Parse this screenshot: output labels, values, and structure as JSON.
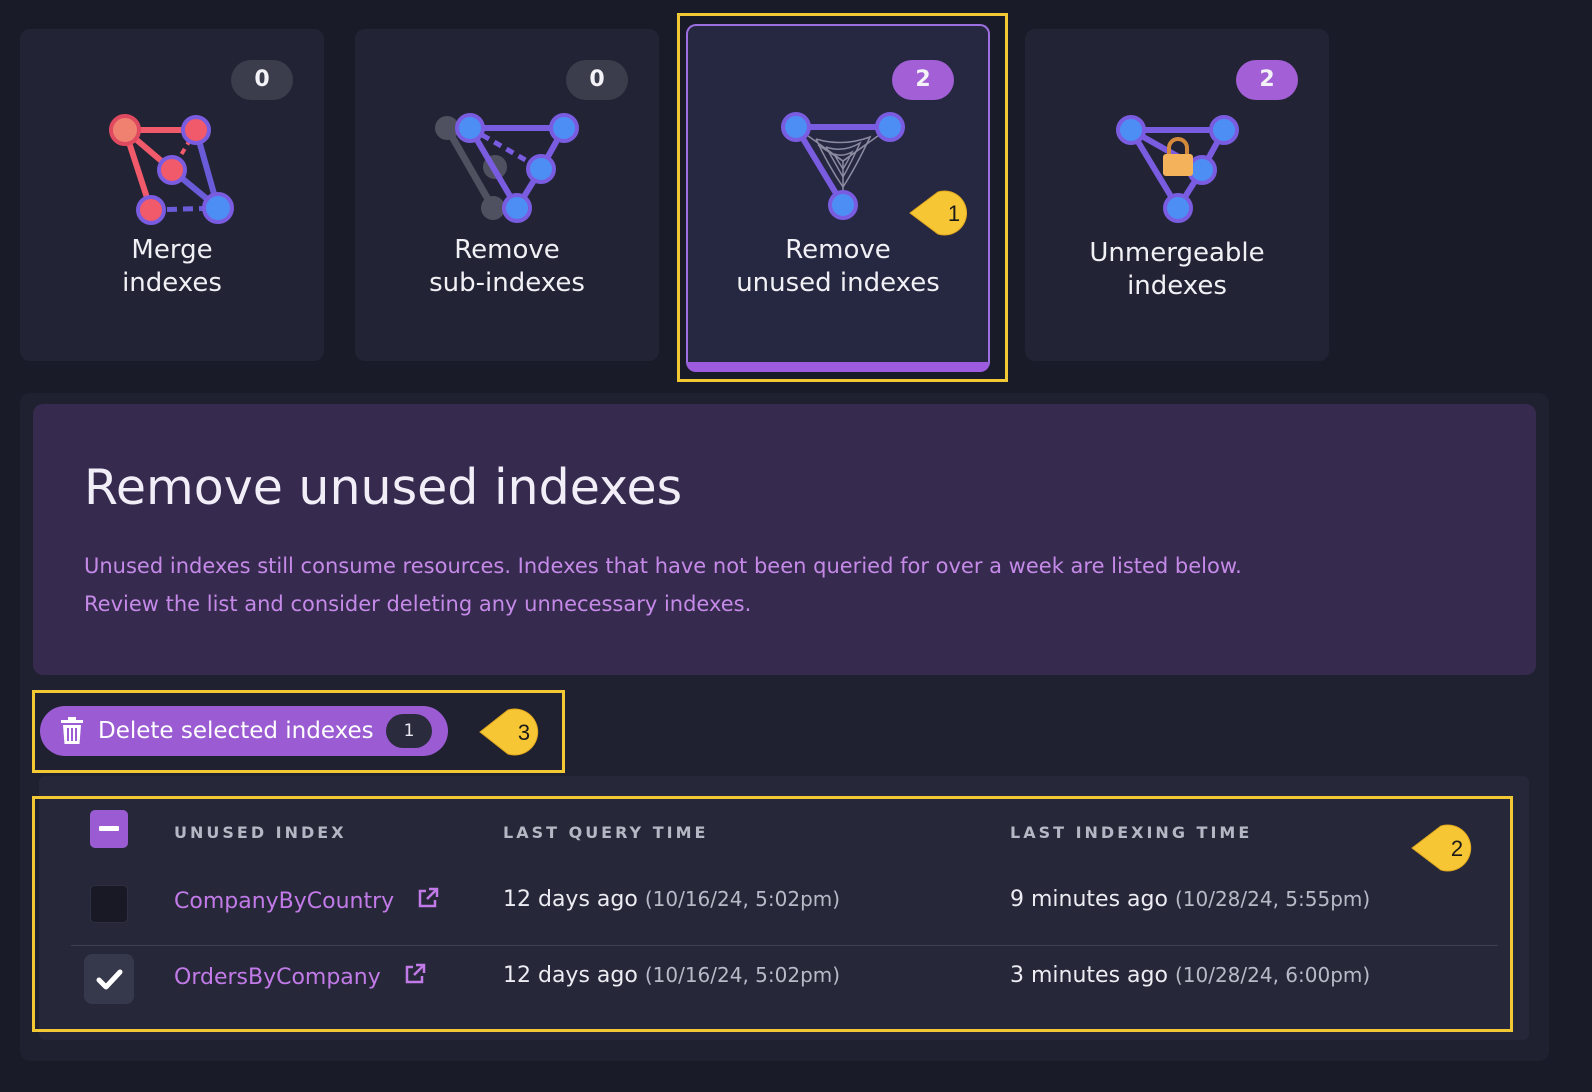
{
  "cards": [
    {
      "line1": "Merge",
      "line2": "indexes",
      "count": "0"
    },
    {
      "line1": "Remove",
      "line2": "sub-indexes",
      "count": "0"
    },
    {
      "line1": "Remove",
      "line2": "unused indexes",
      "count": "2"
    },
    {
      "line1": "Unmergeable",
      "line2": "indexes",
      "count": "2"
    }
  ],
  "callouts": {
    "one": "1",
    "two": "2",
    "three": "3"
  },
  "info": {
    "title": "Remove unused indexes",
    "line1": "Unused indexes still consume resources. Indexes that have not been queried for over a week are listed below.",
    "line2": "Review the list and consider deleting any unnecessary indexes."
  },
  "delete_button": {
    "label": "Delete selected indexes",
    "count": "1"
  },
  "table": {
    "headers": [
      "UNUSED INDEX",
      "LAST QUERY TIME",
      "LAST INDEXING TIME"
    ],
    "rows": [
      {
        "name": "CompanyByCountry",
        "query": "12 days ago",
        "query_date": "(10/16/24, 5:02pm)",
        "indexing": "9 minutes ago",
        "indexing_date": "(10/28/24, 5:55pm)",
        "checked": false
      },
      {
        "name": "OrdersByCompany",
        "query": "12 days ago",
        "query_date": "(10/16/24, 5:02pm)",
        "indexing": "3 minutes ago",
        "indexing_date": "(10/28/24, 6:00pm)",
        "checked": true
      }
    ]
  },
  "colors": {
    "accent": "#9b5bd3",
    "highlight": "#f2c834",
    "link": "#c27ae8"
  }
}
